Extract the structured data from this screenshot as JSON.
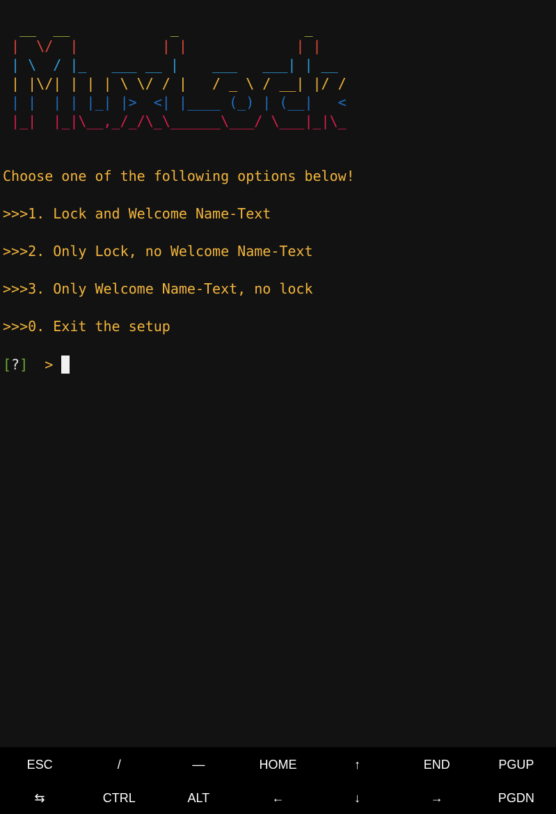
{
  "terminal": {
    "banner": [
      {
        "text": "  __  __            _               _",
        "color": "#a0c23a"
      },
      {
        "text": " |  \\/  |          | |             | |",
        "color": "#e0483a"
      },
      {
        "text": " | \\  / |_   ___ __ |    ___   ___| | __",
        "color": "#2f9bd8"
      },
      {
        "text": " | |\\/| | | | \\ \\/ / |   / _ \\ / __| |/ /",
        "color": "#f2b53c"
      },
      {
        "text": " | |  | | |_| |>  <| |____ (_) | (__|   <",
        "color": "#1f6ec2"
      },
      {
        "text": " |_|  |_|\\__,_/_/\\_\\______\\___/ \\___|_|\\_",
        "color": "#d81e4e"
      }
    ],
    "lines": [
      "Choose one of the following options below!",
      ">>>1. Lock and Welcome Name-Text",
      ">>>2. Only Lock, no Welcome Name-Text",
      ">>>3. Only Welcome Name-Text, no lock",
      ">>>0. Exit the setup"
    ],
    "prompt": {
      "bracket_open": "[",
      "question": "?",
      "bracket_close": "]",
      "arrow": "  > "
    },
    "colors": {
      "text": "#f2b53c",
      "prompt_bracket": "#6aab3a",
      "prompt_question": "#e6e6e6",
      "cursor": "#f2f2f2"
    }
  },
  "extra_keys": {
    "row1": [
      "ESC",
      "/",
      "—",
      "HOME",
      "↑",
      "END",
      "PGUP"
    ],
    "row2": [
      "⇆",
      "CTRL",
      "ALT",
      "←",
      "↓",
      "→",
      "PGDN"
    ]
  }
}
